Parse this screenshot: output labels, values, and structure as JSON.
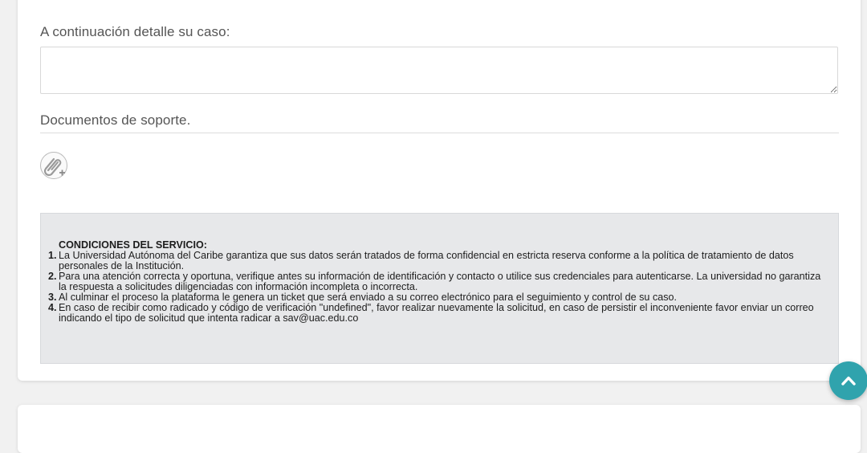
{
  "form": {
    "details_label": "A continuación detalle su caso:",
    "details_value": "",
    "docs_label": "Documentos de soporte."
  },
  "icons": {
    "attach": "paperclip-plus-icon",
    "scroll_top": "chevron-up-icon"
  },
  "conditions": {
    "title": "CONDICIONES DEL SERVICIO:",
    "items": [
      {
        "num": "1.",
        "text": "La Universidad Autónoma del Caribe garantiza que sus datos serán tratados de forma confidencial en estricta reserva conforme a la política de tratamiento de datos personales de la Institución."
      },
      {
        "num": "2.",
        "text": "Para una atención correcta y oportuna, verifique antes su información de identificación y contacto o utilice sus credenciales para autenticarse. La universidad no garantiza la respuesta a solicitudes diligenciadas con información incompleta o incorrecta."
      },
      {
        "num": "3.",
        "text": "Al culminar el proceso la plataforma le genera un ticket que será enviado a su correo electrónico para el seguimiento y control de su caso."
      },
      {
        "num": "4.",
        "text": "En caso de recibir como radicado y código de verificación \"undefined\", favor realizar nuevamente la solicitud, en caso de persistir el inconveniente favor enviar un correo indicando el tipo de solicitud que intenta radicar a sav@uac.edu.co"
      }
    ]
  },
  "colors": {
    "accent": "#30a3ad",
    "conditions_bg": "#e7e8ea"
  }
}
